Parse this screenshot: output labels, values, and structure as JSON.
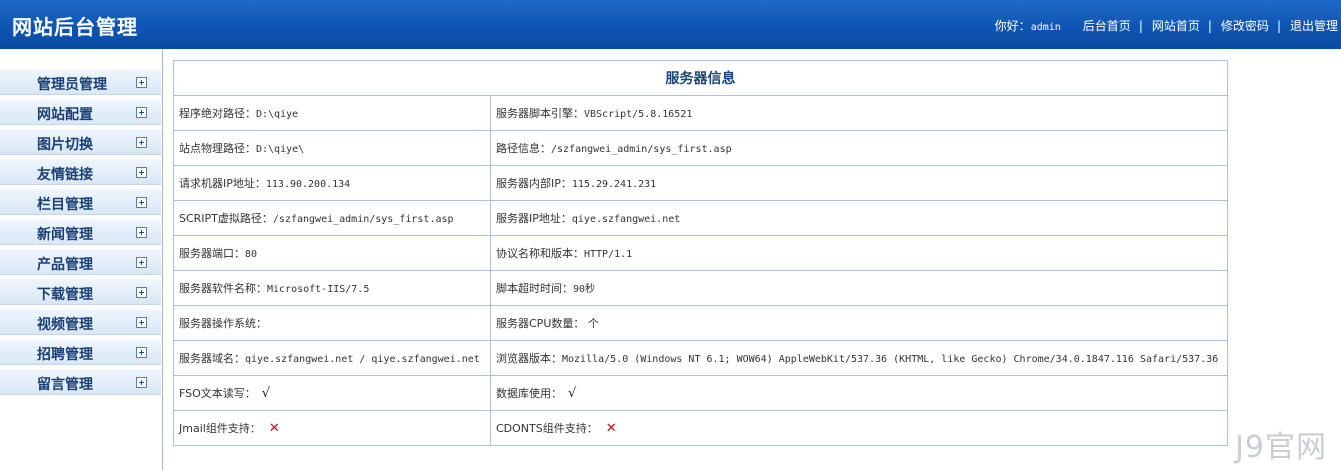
{
  "header": {
    "title": "网站后台管理",
    "greeting_prefix": "你好：",
    "username": "admin",
    "links": [
      "后台首页",
      "网站首页",
      "修改密码",
      "退出管理"
    ],
    "separator": "|"
  },
  "sidebar": {
    "items": [
      {
        "label": "管理员管理"
      },
      {
        "label": "网站配置"
      },
      {
        "label": "图片切换"
      },
      {
        "label": "友情链接"
      },
      {
        "label": "栏目管理"
      },
      {
        "label": "新闻管理"
      },
      {
        "label": "产品管理"
      },
      {
        "label": "下载管理"
      },
      {
        "label": "视频管理"
      },
      {
        "label": "招聘管理"
      },
      {
        "label": "留言管理"
      }
    ]
  },
  "server_info": {
    "title": "服务器信息",
    "rows": [
      [
        {
          "label": "程序绝对路径：",
          "value": "D:\\qiye"
        },
        {
          "label": "服务器脚本引擎：",
          "value": "VBScript/5.8.16521"
        }
      ],
      [
        {
          "label": "站点物理路径：",
          "value": "D:\\qiye\\"
        },
        {
          "label": "路径信息：",
          "value": "/szfangwei_admin/sys_first.asp"
        }
      ],
      [
        {
          "label": "请求机器IP地址：",
          "value": "113.90.200.134"
        },
        {
          "label": "服务器内部IP：",
          "value": "115.29.241.231"
        }
      ],
      [
        {
          "label": "SCRIPT虚拟路径：",
          "value": "/szfangwei_admin/sys_first.asp"
        },
        {
          "label": "服务器IP地址：",
          "value": "qiye.szfangwei.net"
        }
      ],
      [
        {
          "label": "服务器端口：",
          "value": "80"
        },
        {
          "label": "协议名称和版本：",
          "value": "HTTP/1.1"
        }
      ],
      [
        {
          "label": "服务器软件名称：",
          "value": "Microsoft-IIS/7.5"
        },
        {
          "label": "脚本超时时间：",
          "value": "90秒"
        }
      ],
      [
        {
          "label": "服务器操作系统：",
          "value": ""
        },
        {
          "label": "服务器CPU数量：",
          "value": " 个"
        }
      ],
      [
        {
          "label": "服务器域名：",
          "value": "qiye.szfangwei.net / qiye.szfangwei.net"
        },
        {
          "label": "浏览器版本：",
          "value": "Mozilla/5.0 (Windows NT 6.1; WOW64) AppleWebKit/537.36 (KHTML, like Gecko) Chrome/34.0.1847.116 Safari/537.36"
        }
      ]
    ],
    "checks": [
      {
        "label": "FSO文本读写：",
        "status": "ok"
      },
      {
        "label": "数据库使用：",
        "status": "ok"
      },
      {
        "label": "Jmail组件支持：",
        "status": "no"
      },
      {
        "label": "CDONTS组件支持：",
        "status": "no"
      }
    ],
    "ok_glyph": "√",
    "no_glyph": "✕"
  },
  "watermark": "J9官网",
  "colors": {
    "header_bg": "#0f55b3",
    "title_text": "#1b4679",
    "border": "#a7c3e0",
    "no_mark": "#d0021b"
  }
}
